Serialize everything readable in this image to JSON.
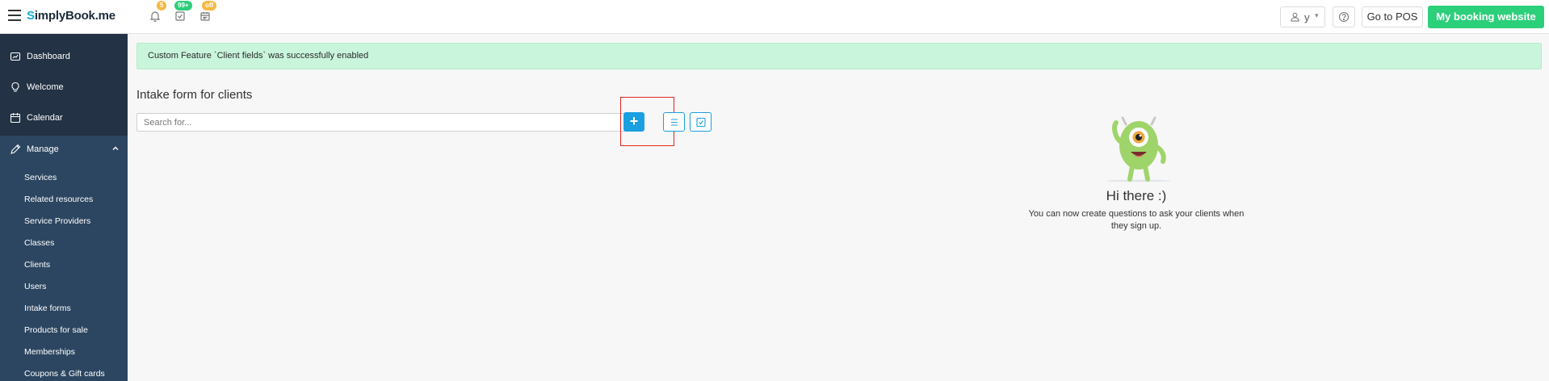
{
  "header": {
    "logo_text": "implyBook",
    "logo_prefix": "S",
    "logo_suffix": ".me",
    "notifications_badge": "5",
    "tasks_badge": "99+",
    "calendar_badge": "off",
    "user_label": "y",
    "go_to_pos_label": "Go to POS",
    "booking_site_label": "My booking website"
  },
  "sidebar": {
    "items": [
      {
        "label": "Dashboard",
        "icon": "dashboard-icon"
      },
      {
        "label": "Welcome",
        "icon": "lightbulb-icon"
      },
      {
        "label": "Calendar",
        "icon": "calendar-icon"
      },
      {
        "label": "Manage",
        "icon": "pencil-icon"
      }
    ],
    "manage_children": [
      "Services",
      "Related resources",
      "Service Providers",
      "Classes",
      "Clients",
      "Users",
      "Intake forms",
      "Products for sale",
      "Memberships",
      "Coupons & Gift cards"
    ]
  },
  "main": {
    "alert_text": "Custom Feature `Client fields` was successfully enabled",
    "title": "Intake form for clients",
    "search_placeholder": "Search for...",
    "add_label": "+",
    "empty_title": "Hi there :)",
    "empty_text": "You can now create questions to ask your clients when they sign up."
  },
  "colors": {
    "accent": "#1a9fe0",
    "success": "#2ccf7a",
    "sidebar": "#233244",
    "highlight": "#e32424"
  }
}
